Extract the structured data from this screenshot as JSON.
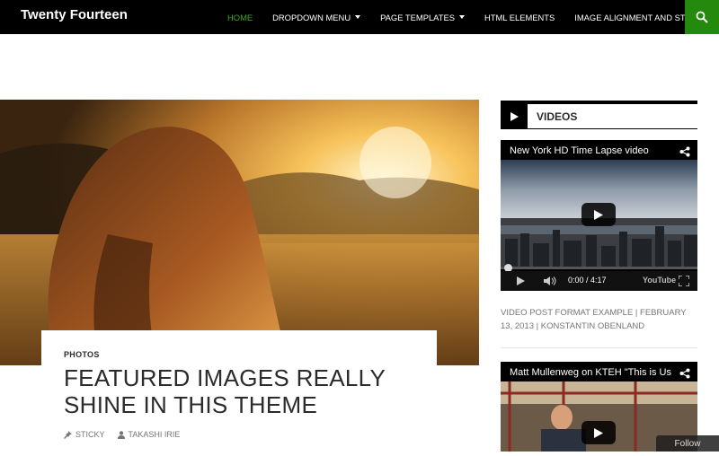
{
  "site": {
    "title": "Twenty Fourteen"
  },
  "nav": {
    "items": [
      {
        "label": "HOME",
        "active": true,
        "has_dropdown": false
      },
      {
        "label": "DROPDOWN MENU",
        "active": false,
        "has_dropdown": true
      },
      {
        "label": "PAGE TEMPLATES",
        "active": false,
        "has_dropdown": true
      },
      {
        "label": "HTML ELEMENTS",
        "active": false,
        "has_dropdown": false
      },
      {
        "label": "IMAGE ALIGNMENT AND STYLES",
        "active": false,
        "has_dropdown": false
      }
    ],
    "search_icon": "search-icon"
  },
  "post": {
    "category": "PHOTOS",
    "title": "FEATURED IMAGES REALLY SHINE IN THIS THEME",
    "meta_sticky": "STICKY",
    "meta_author": "TAKASHI IRIE"
  },
  "sidebar": {
    "widget_title": "VIDEOS",
    "video1": {
      "title": "New York HD Time Lapse video",
      "time": "0:00 / 4:17",
      "brand": "YouTube",
      "progress": 0
    },
    "video_caption": "VIDEO POST FORMAT EXAMPLE | FEBRUARY 13, 2013 | KONSTANTIN OBENLAND",
    "video2": {
      "title": "Matt Mullenweg on KTEH \"This is Us"
    }
  },
  "follow": {
    "label": "Follow"
  },
  "colors": {
    "accent": "#41a62a",
    "search_bg": "#24890d",
    "topbar": "#000000"
  }
}
